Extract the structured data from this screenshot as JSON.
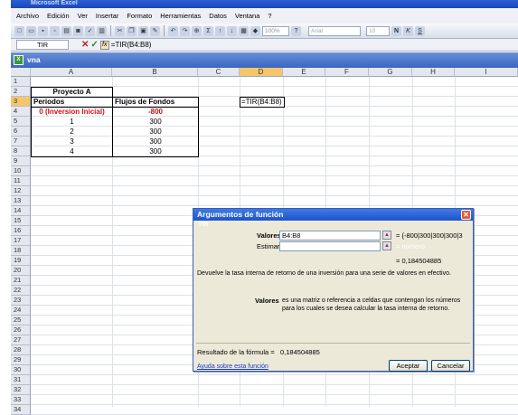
{
  "app": {
    "title": "Microsoft Excel"
  },
  "menu": [
    "Archivo",
    "Edición",
    "Ver",
    "Insertar",
    "Formato",
    "Herramientas",
    "Datos",
    "Ventana",
    "?"
  ],
  "toolbar": {
    "zoom": "100%",
    "font": "Arial",
    "size": "10"
  },
  "formula_bar": {
    "name_box": "TIR",
    "formula": "=TIR(B4:B8)"
  },
  "workbook": {
    "title": "vna"
  },
  "columns": [
    "A",
    "B",
    "C",
    "D",
    "E",
    "F",
    "G",
    "H",
    "I"
  ],
  "rows": [
    "1",
    "2",
    "3",
    "4",
    "5",
    "6",
    "7",
    "8",
    "9",
    "10",
    "11",
    "12",
    "13",
    "14",
    "15",
    "16",
    "17",
    "18",
    "19",
    "20",
    "21",
    "22",
    "23",
    "24",
    "25",
    "26",
    "27",
    "28",
    "29",
    "30",
    "31",
    "32",
    "33",
    "34"
  ],
  "sheet": {
    "project_title": "Proyecto A",
    "col_a_header": "Periodos",
    "col_b_header": "Flujos de Fondos",
    "periods": [
      "0 (Inversion Inicial)",
      "1",
      "2",
      "3",
      "4"
    ],
    "flows": [
      "-800",
      "300",
      "300",
      "300",
      "300"
    ],
    "d3_formula": "=TIR(B4:B8)"
  },
  "dialog": {
    "title": "Argumentos de función",
    "function": "TIR",
    "valores_label": "Valores",
    "valores_value": "B4:B8",
    "valores_result": "= {-800|300|300|300|3",
    "estimar_label": "Estimar",
    "estimar_result": "= número",
    "result_value": "= 0,184504885",
    "description": "Devuelve la tasa interna de retorno de una inversión para una serie de valores en efectivo.",
    "arg_name": "Valores",
    "arg_desc": "es una matriz o referencia a celdas que contengan los números para los cuales se desea calcular la tasa interna de retorno.",
    "formula_result_label": "Resultado de la fórmula =",
    "formula_result": "0,184504885",
    "help_link": "Ayuda sobre esta función",
    "ok": "Aceptar",
    "cancel": "Cancelar"
  }
}
